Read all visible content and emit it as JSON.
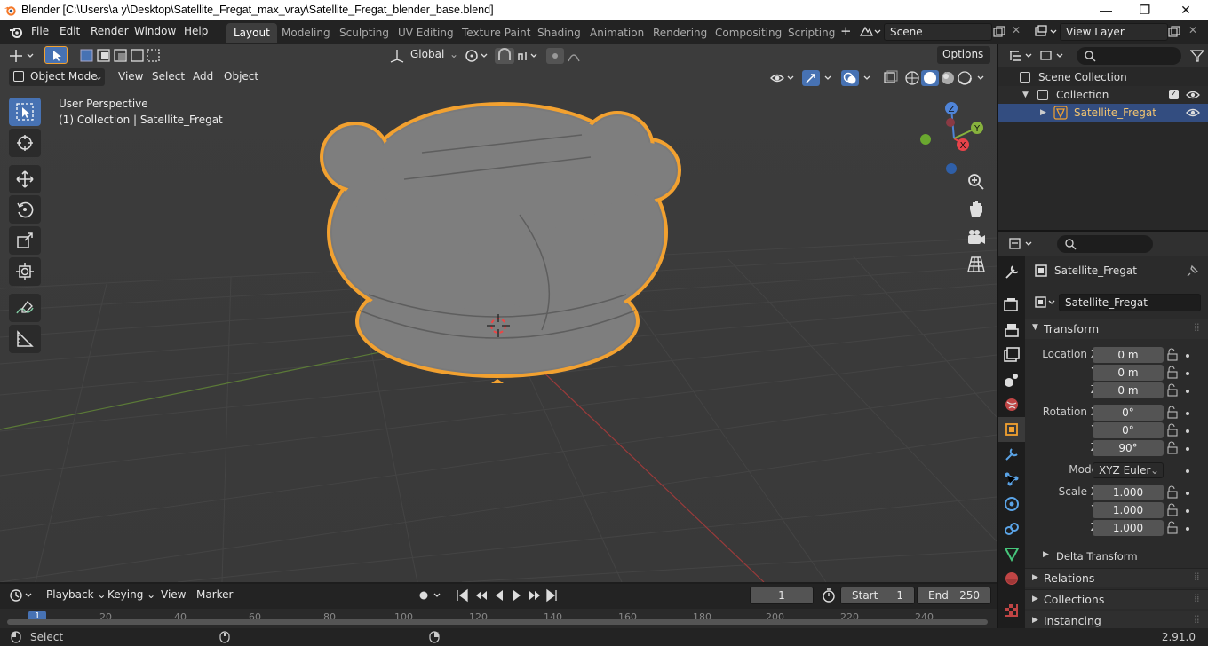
{
  "window": {
    "title": "Blender [C:\\Users\\a y\\Desktop\\Satellite_Fregat_max_vray\\Satellite_Fregat_blender_base.blend]",
    "minimize": "—",
    "maximize": "❐",
    "close": "✕"
  },
  "menus": [
    "File",
    "Edit",
    "Render",
    "Window",
    "Help"
  ],
  "workspaces": [
    "Layout",
    "Modeling",
    "Sculpting",
    "UV Editing",
    "Texture Paint",
    "Shading",
    "Animation",
    "Rendering",
    "Compositing",
    "Scripting"
  ],
  "active_workspace": "Layout",
  "add_workspace": "+",
  "scene": {
    "name": "Scene",
    "view_layer": "View Layer"
  },
  "viewport": {
    "transform_orientation": "Global",
    "options_label": "Options",
    "mode": "Object Mode",
    "header_menus": [
      "View",
      "Select",
      "Add",
      "Object"
    ],
    "overlay_text_line1": "User Perspective",
    "overlay_text_line2": "(1) Collection | Satellite_Fregat",
    "gizmo": {
      "x": "X",
      "y": "Y",
      "z": "Z"
    }
  },
  "outliner": {
    "scene_collection": "Scene Collection",
    "collection": "Collection",
    "object": "Satellite_Fregat"
  },
  "properties": {
    "object_name": "Satellite_Fregat",
    "data_name": "Satellite_Fregat",
    "panel_transform": "Transform",
    "location": {
      "label": "Location X",
      "x": "0 m",
      "y": "0 m",
      "z": "0 m"
    },
    "rotation": {
      "label": "Rotation X",
      "x": "0°",
      "y": "0°",
      "z": "90°"
    },
    "mode_label": "Mode",
    "mode_value": "XYZ Euler",
    "scale": {
      "label": "Scale X",
      "x": "1.000",
      "y": "1.000",
      "z": "1.000"
    },
    "axis_y": "Y",
    "axis_z": "Z",
    "delta_transform": "Delta Transform",
    "relations": "Relations",
    "collections": "Collections",
    "instancing": "Instancing"
  },
  "timeline": {
    "menus": [
      "Playback",
      "Keying",
      "View",
      "Marker"
    ],
    "current_frame": "1",
    "start_label": "Start",
    "start_value": "1",
    "end_label": "End",
    "end_value": "250",
    "ruler_marks": [
      "20",
      "40",
      "60",
      "80",
      "100",
      "120",
      "140",
      "160",
      "180",
      "200",
      "220",
      "240"
    ],
    "playhead_label": "1"
  },
  "status": {
    "left": "Select",
    "version": "2.91.0"
  },
  "colors": {
    "accent": "#4772b3",
    "selection_outline": "#f2a130",
    "x_axis": "#e8434a",
    "y_axis": "#87b23d",
    "z_axis": "#4f84d8"
  }
}
